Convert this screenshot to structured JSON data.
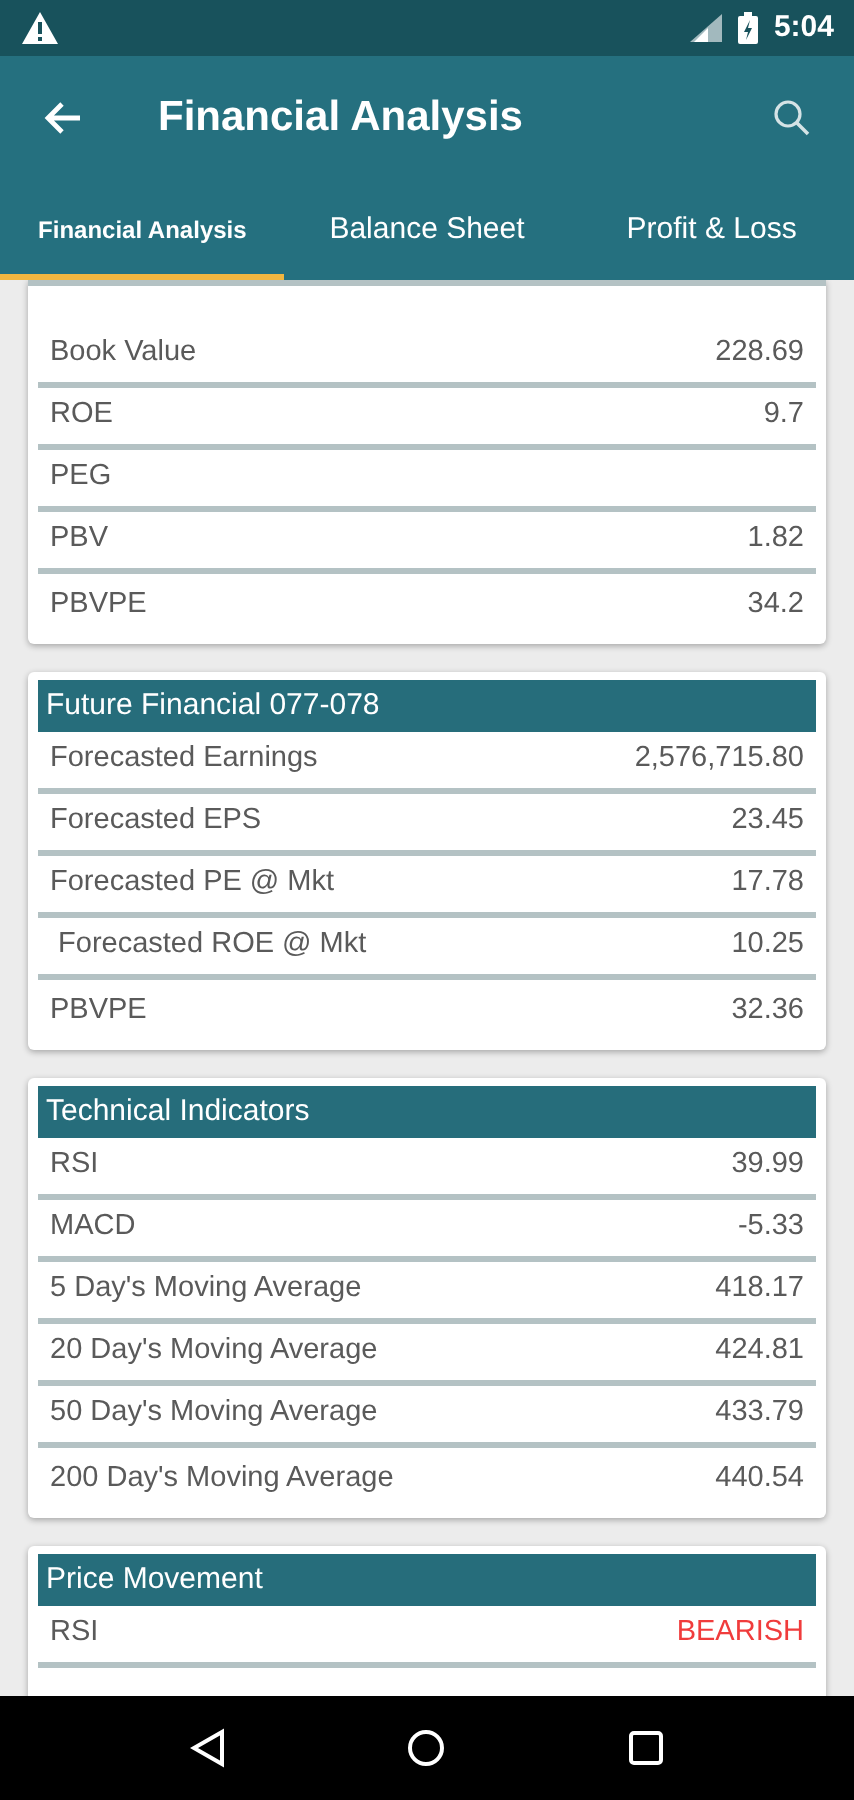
{
  "status_bar": {
    "time": "5:04"
  },
  "app_bar": {
    "title": "Financial Analysis"
  },
  "tabs": [
    {
      "label": "Financial Analysis",
      "selected": true
    },
    {
      "label": "Balance Sheet",
      "selected": false
    },
    {
      "label": "Profit & Loss",
      "selected": false
    }
  ],
  "sections": [
    {
      "rows": [
        {
          "label": "Book Value",
          "value": "228.69"
        },
        {
          "label": "ROE",
          "value": "9.7"
        },
        {
          "label": "PEG"
        },
        {
          "label": "PBV",
          "value": "1.82"
        },
        {
          "label": "PBVPE",
          "value": "34.2"
        }
      ]
    },
    {
      "title": "Future Financial 077-078",
      "rows": [
        {
          "label": "Forecasted Earnings",
          "value": "2,576,715.80"
        },
        {
          "label": "Forecasted EPS",
          "value": "23.45"
        },
        {
          "label": "Forecasted PE @ Mkt",
          "value": "17.78"
        },
        {
          "label": " Forecasted ROE @ Mkt",
          "value": "10.25"
        },
        {
          "label": "PBVPE",
          "value": "32.36"
        }
      ]
    },
    {
      "title": "Technical Indicators",
      "rows": [
        {
          "label": "RSI",
          "value": "39.99"
        },
        {
          "label": "MACD",
          "value": "-5.33"
        },
        {
          "label": "5 Day's Moving Average",
          "value": "418.17"
        },
        {
          "label": "20 Day's Moving Average",
          "value": "424.81"
        },
        {
          "label": "50 Day's Moving Average",
          "value": "433.79"
        },
        {
          "label": "200 Day's Moving Average",
          "value": "440.54"
        }
      ]
    },
    {
      "title": "Price Movement",
      "rows": [
        {
          "label": "RSI",
          "value": "BEARISH",
          "color": "#f03c3c"
        }
      ]
    }
  ]
}
